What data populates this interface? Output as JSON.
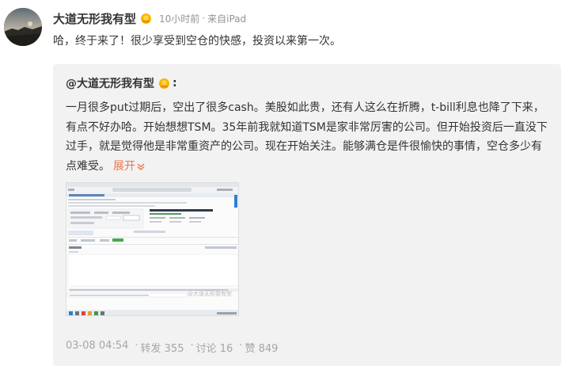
{
  "post": {
    "username": "大道无形我有型",
    "badge_icon": "sun-badge-icon",
    "time": "10小时前",
    "source": "来自iPad",
    "text": "哈，终于来了！很少享受到空仓的快感，投资以来第一次。"
  },
  "repost": {
    "username": "@大道无形我有型",
    "colon": ":",
    "text": "一月很多put过期后，空出了很多cash。美股如此贵，还有人这么在折腾，t-bill利息也降了下来，有点不好办哈。开始想想TSM。35年前我就知道TSM是家非常厉害的公司。但开始投资后一直没下过手，就是觉得他是非常重资产的公司。现在开始关注。能够满仓是件很愉快的事情，空仓多少有点难受。",
    "expand_label": "展开",
    "image_watermark": "@大道无形我有型",
    "date": "03-08 04:54",
    "repost_label": "转发 355",
    "comment_label": "讨论 16",
    "like_label": "赞 849"
  },
  "colors": {
    "link": "#eb7350",
    "meta": "#939393",
    "card_bg": "#f2f2f2"
  }
}
